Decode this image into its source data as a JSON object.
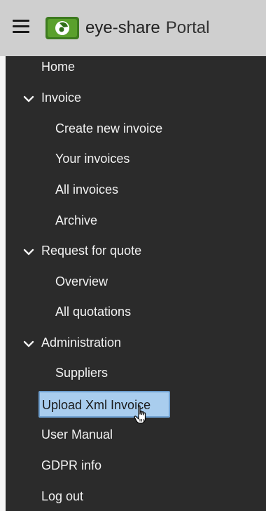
{
  "header": {
    "brand_name": "eye-share",
    "brand_suffix": "Portal",
    "menu_icon": "hamburger-menu-icon",
    "logo_icon": "eye-share-logo-icon",
    "header_bg": "#cfcfcf",
    "logo_green": "#3d7a1f"
  },
  "nav": {
    "home": "Home",
    "invoice": "Invoice",
    "create_new_invoice": "Create new invoice",
    "your_invoices": "Your invoices",
    "all_invoices": "All invoices",
    "archive": "Archive",
    "request_for_quote": "Request for quote",
    "overview": "Overview",
    "all_quotations": "All quotations",
    "administration": "Administration",
    "suppliers": "Suppliers",
    "upload_xml_invoice": "Upload Xml Invoice",
    "user_manual": "User Manual",
    "gdpr_info": "GDPR info",
    "log_out": "Log out",
    "sidebar_bg": "#2b2b2b",
    "highlight_bg": "#a9cdee",
    "chevron_icon": "chevron-down-icon",
    "cursor_icon": "hand-pointer-cursor-icon"
  }
}
